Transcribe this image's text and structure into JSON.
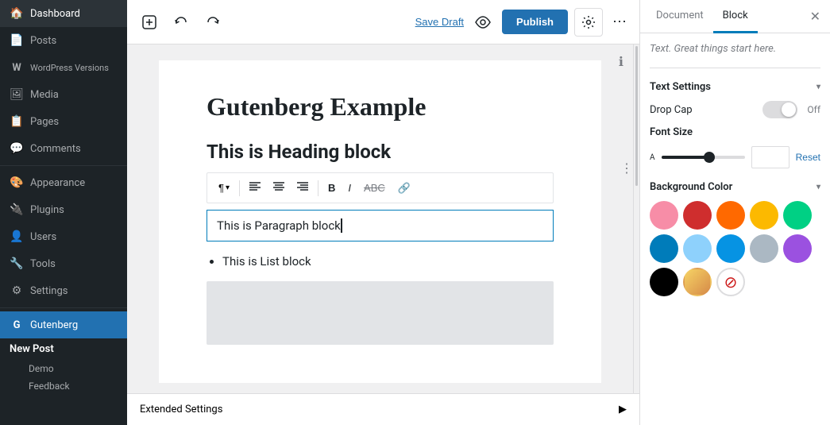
{
  "sidebar": {
    "items": [
      {
        "id": "dashboard",
        "label": "Dashboard",
        "icon": "🏠"
      },
      {
        "id": "posts",
        "label": "Posts",
        "icon": "📄"
      },
      {
        "id": "wordpress-versions",
        "label": "WordPress Versions",
        "icon": "W"
      },
      {
        "id": "media",
        "label": "Media",
        "icon": "🖼"
      },
      {
        "id": "pages",
        "label": "Pages",
        "icon": "📋"
      },
      {
        "id": "comments",
        "label": "Comments",
        "icon": "💬"
      },
      {
        "id": "appearance",
        "label": "Appearance",
        "icon": "🎨"
      },
      {
        "id": "plugins",
        "label": "Plugins",
        "icon": "🔌"
      },
      {
        "id": "users",
        "label": "Users",
        "icon": "👤"
      },
      {
        "id": "tools",
        "label": "Tools",
        "icon": "🔧"
      },
      {
        "id": "settings",
        "label": "Settings",
        "icon": "⚙"
      }
    ],
    "active_item": "gutenberg",
    "gutenberg_item": {
      "label": "Gutenberg",
      "icon": "G"
    },
    "new_post_label": "New Post",
    "sub_items": [
      "Demo",
      "Feedback"
    ]
  },
  "toolbar": {
    "save_draft_label": "Save Draft",
    "publish_label": "Publish"
  },
  "editor": {
    "title": "Gutenberg Example",
    "heading_text": "This is Heading block",
    "paragraph_text": "This is Paragraph block",
    "list_item": "This is List block",
    "extended_settings_label": "Extended Settings",
    "info_tooltip": "ℹ"
  },
  "panel": {
    "document_tab": "Document",
    "block_tab": "Block",
    "placeholder_text": "Text. Great things start here.",
    "text_settings_label": "Text Settings",
    "drop_cap_label": "Drop Cap",
    "drop_cap_state": "Off",
    "font_size_label": "Font Size",
    "font_size_a_small": "A",
    "font_size_reset": "Reset",
    "background_color_label": "Background Color",
    "colors": [
      {
        "hex": "#f78da7",
        "name": "pale-pink"
      },
      {
        "hex": "#cf2e2e",
        "name": "vivid-red"
      },
      {
        "hex": "#ff6900",
        "name": "luminous-vivid-orange"
      },
      {
        "hex": "#fcb900",
        "name": "luminous-vivid-amber"
      },
      {
        "hex": "#00d084",
        "name": "light-green-cyan"
      },
      {
        "hex": "#007cba",
        "name": "vivid-cyan-blue"
      },
      {
        "hex": "#8ed1fc",
        "name": "light-blue"
      },
      {
        "hex": "#0693e3",
        "name": "cyan-bluish-gray"
      },
      {
        "hex": "#abb8c3",
        "name": "cool-gray"
      },
      {
        "hex": "#9b51e0",
        "name": "purple"
      },
      {
        "hex": "#000000",
        "name": "black"
      },
      {
        "hex": "#d18b68",
        "name": "gradient"
      },
      {
        "hex": "none",
        "name": "no-color"
      }
    ],
    "colors_row1": [
      {
        "hex": "#f78da7",
        "name": "pale-pink"
      },
      {
        "hex": "#cf2e2e",
        "name": "vivid-red"
      },
      {
        "hex": "#ff6900",
        "name": "luminous-vivid-orange"
      },
      {
        "hex": "#fcb900",
        "name": "luminous-vivid-amber"
      },
      {
        "hex": "#00d084",
        "name": "light-green-cyan"
      }
    ],
    "colors_row2": [
      {
        "hex": "#007cba",
        "name": "vivid-cyan-blue"
      },
      {
        "hex": "#8ed1fc",
        "name": "light-blue"
      },
      {
        "hex": "#0693e3",
        "name": "cyan-blue"
      },
      {
        "hex": "#abb8c3",
        "name": "cool-gray"
      },
      {
        "hex": "#9b51e0",
        "name": "purple"
      }
    ],
    "colors_row3": [
      {
        "hex": "#000000",
        "name": "black"
      },
      {
        "hex": "#d68a48",
        "name": "gradient-dark"
      },
      {
        "hex": "none",
        "name": "no-color"
      }
    ]
  }
}
